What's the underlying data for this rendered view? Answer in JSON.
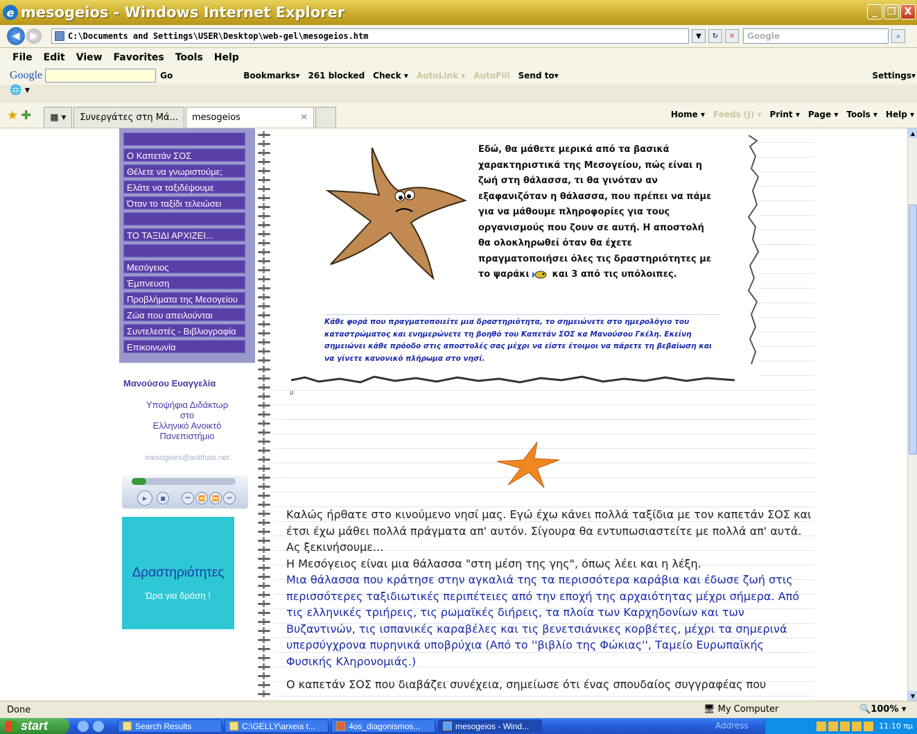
{
  "window": {
    "title": "mesogeios - Windows Internet Explorer",
    "minimize": "_",
    "maximize": "❐",
    "close": "X"
  },
  "address_bar": {
    "url": "C:\\Documents and Settings\\USER\\Desktop\\web-gel\\mesogeios.htm",
    "search_placeholder": "Google"
  },
  "menu": [
    "File",
    "Edit",
    "View",
    "Favorites",
    "Tools",
    "Help"
  ],
  "google_toolbar": {
    "logo": "Google",
    "items": [
      "Go",
      "Bookmarks▾",
      "261 blocked",
      "Check ▾",
      "AutoLink ▾",
      "AutoFill",
      "Send to▾"
    ],
    "settings": "Settings▾"
  },
  "tabs": [
    {
      "label": "Συνεργάτες στη Μά...",
      "active": false
    },
    {
      "label": "mesogeios",
      "active": true
    }
  ],
  "command_bar": [
    "Home ▾",
    "Feeds (J) ▾",
    "Print ▾",
    "Page ▾",
    "Tools ▾",
    "Help ▾"
  ],
  "sidebar": {
    "items": [
      {
        "label": "",
        "blank": true
      },
      {
        "label": "Ο Καπετάν ΣΟΣ"
      },
      {
        "label": "Θέλετε να γνωριστούμε;"
      },
      {
        "label": "Ελάτε να ταξιδέψουμε"
      },
      {
        "label": "Όταν το ταξίδι τελειώσει"
      },
      {
        "label": "",
        "blank": true
      },
      {
        "label": "ΤΟ ΤΑΞΙΔΙ ΑΡΧΙΖΕΙ..."
      },
      {
        "label": "",
        "blank": true
      },
      {
        "label": "Μεσόγειος"
      },
      {
        "label": "Έμπνευση"
      },
      {
        "label": "Προβλήματα της Μεσογείου"
      },
      {
        "label": "Ζώα που απειλούνται"
      },
      {
        "label": "Συντελεστές - Βιβλιογραφία"
      },
      {
        "label": "Επικοινωνία"
      }
    ]
  },
  "author": {
    "name": "Μανούσου Ευαγγελία",
    "role_line1": "Υποψήφια Διδάκτωρ",
    "role_line2": "στο",
    "role_line3": "Ελληνικό Ανοικτό",
    "role_line4": "Πανεπιστήμιο",
    "email": "mesogeios@antthais.net"
  },
  "player": {
    "progress": 0.14
  },
  "activities": {
    "title": "Δραστηριότητες",
    "subtitle": "Ώρα για δράση !"
  },
  "intro": {
    "text": "Εδώ, θα μάθετε μερικά από τα βασικά χαρακτηριστικά της Μεσογείου, πώς είναι η ζωή στη θάλασσα, τι θα γινόταν αν εξαφανιζόταν η θάλασσα, που πρέπει να πάμε για να μάθουμε πληροφορίες για τους οργανισμούς που ζουν σε αυτή. Η αποστολή θα ολοκληρωθεί όταν θα έχετε πραγματοποιήσει όλες τις δραστηριότητες με",
    "tail_before": "το ψαράκι",
    "tail_after": "και 3 από τις υπόλοιπες.",
    "note": "Κάθε φορά που πραγματοποιείτε μια δραστηριότητα, το σημειώνετε στο ημερολόγιο του καταστρώματος και ενημερώνετε τη βοηθό του Καπετάν ΣΟΣ κα Μανούσου Γκέλη. Εκείνη σημειώνει κάθε πρόοδο στις αποστολές σας μέχρι να είστε έτοιμοι να πάρετε τη βεβαίωση και να γίνετε κανονικό πλήρωμα στο νησί.",
    "mu": "μ"
  },
  "body": {
    "p1": "Καλώς ήρθατε στο κινούμενο νησί μας. Εγώ έχω κάνει πολλά ταξίδια με τον καπετάν ΣΟΣ και έτσι έχω μάθει πολλά πράγματα απ' αυτόν. Σίγουρα θα εντυπωσιαστείτε με πολλά απ' αυτά. Ας ξεκινήσουμε...",
    "p2": "Η Μεσόγειος είναι μια θάλασσα \"στη μέση της γης\", όπως λέει και η λέξη.",
    "p3": "Μια θάλασσα που κράτησε στην αγκαλιά της τα περισσότερα καράβια και έδωσε ζωή στις περισσότερες ταξιδιωτικές περιπέτειες από την εποχή της αρχαιότητας μέχρι σήμερα. Από τις ελληνικές τριήρεις, τις ρωμαϊκές διήρεις, τα πλοία των Καρχηδονίων και των Βυζαντινών, τις ισπανικές καραβέλες και τις βενετσιάνικες κορβέτες, μέχρι τα σημερινά υπερσύγχρονα πυρηνικά υποβρύχια (Από το ''βιβλίο της Φώκιας'', Ταμείο Ευρωπαϊκής Φυσικής Κληρονομιάς.)",
    "p4": "Ο καπετάν ΣΟΣ που διαβάζει συνέχεια, σημείωσε ότι ένας σπουδαίος συγγραφέας που"
  },
  "status": {
    "text": "Done",
    "zone": "My Computer",
    "zoom": "100%"
  },
  "taskbar": {
    "start": "start",
    "tasks": [
      {
        "label": "Search Results"
      },
      {
        "label": "C:\\GELLY\\arxeia t..."
      },
      {
        "label": "4os_diagonismos..."
      },
      {
        "label": "mesogeios - Wind...",
        "active": true
      }
    ],
    "address_label": "Address",
    "clock": "11:10 πμ"
  }
}
